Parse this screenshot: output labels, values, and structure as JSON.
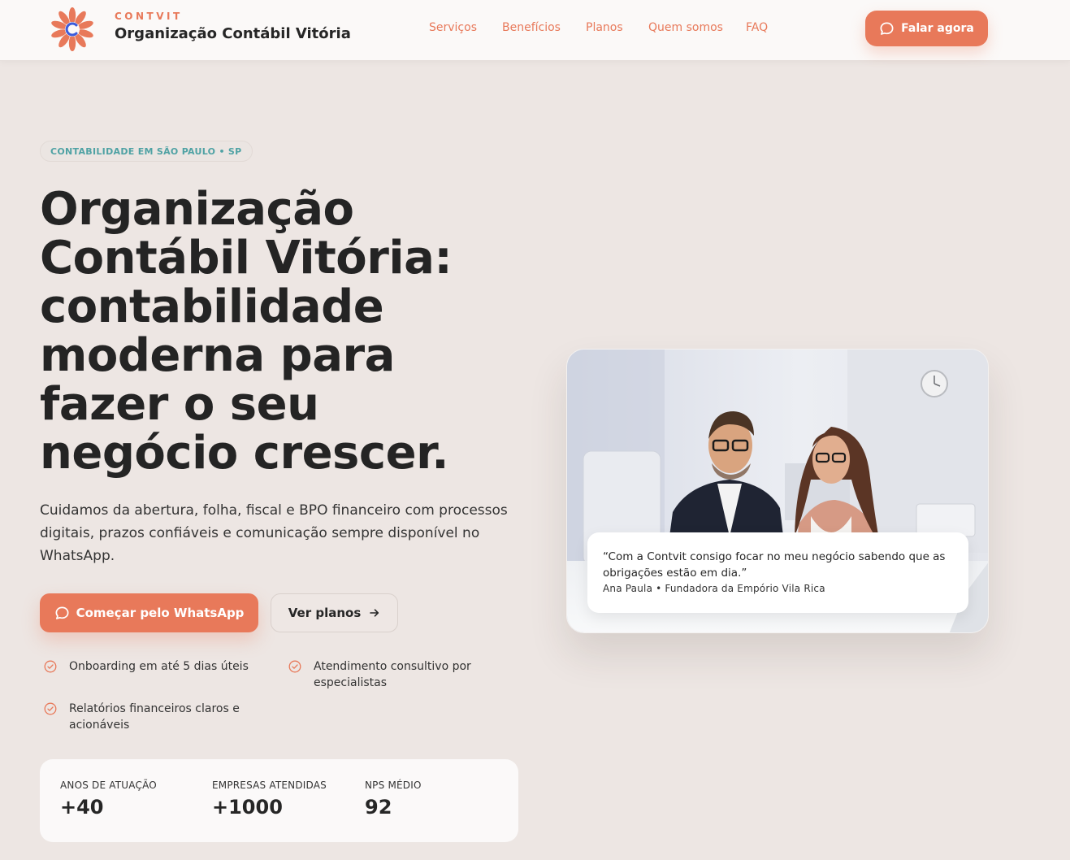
{
  "header": {
    "brand_kicker": "CONTVIT",
    "brand_name": "Organização Contábil Vitória",
    "nav": [
      {
        "label": "Serviços"
      },
      {
        "label": "Benefícios"
      },
      {
        "label": "Planos"
      },
      {
        "label": "Quem somos"
      },
      {
        "label": "FAQ"
      }
    ],
    "cta_label": "Falar agora"
  },
  "hero": {
    "badge": "CONTABILIDADE EM SÃO PAULO • SP",
    "title_lines": [
      "Organização",
      "Contábil Vitória:",
      "contabilidade",
      "moderna para",
      "fazer o seu",
      "negócio crescer."
    ],
    "subtitle": "Cuidamos da abertura, folha, fiscal e BPO financeiro com processos digitais, prazos confiáveis e comunicação sempre disponível no WhatsApp.",
    "primary_button": "Começar pelo WhatsApp",
    "secondary_button": "Ver planos",
    "features": [
      "Onboarding em até 5 dias úteis",
      "Atendimento consultivo por especialistas",
      "Relatórios financeiros claros e acionáveis"
    ]
  },
  "stats": [
    {
      "label": "ANOS DE ATUAÇÃO",
      "value": "+40"
    },
    {
      "label": "EMPRESAS ATENDIDAS",
      "value": "+1000"
    },
    {
      "label": "NPS MÉDIO",
      "value": "92"
    }
  ],
  "testimonial": {
    "quote": "“Com a Contvit consigo focar no meu negócio sabendo que as obrigações estão em dia.”",
    "author": "Ana Paula • Fundadora da Empório Vila Rica"
  },
  "colors": {
    "accent": "#e8795a",
    "teal": "#4fa2a4",
    "background": "#ede6e3",
    "heading": "#242424"
  },
  "icons": {
    "logo": "flower-logo-icon",
    "chat": "chat-bubble-icon",
    "arrow": "arrow-right-icon",
    "check": "check-circle-icon"
  }
}
